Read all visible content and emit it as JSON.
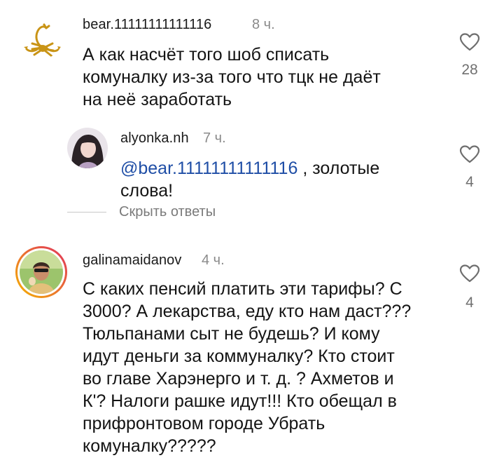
{
  "comments": [
    {
      "username": "bear.11111111111116",
      "time": "8 ч.",
      "text_lines": [
        "А как насчёт того шоб списать",
        "комуналку из-за того что тцк не даёт",
        "на неё заработать"
      ],
      "likes": "28",
      "avatar_icon": "scorpion-icon"
    },
    {
      "username": "alyonka.nh",
      "time": "7 ч.",
      "mention": "@bear.11111111111116",
      "text_after_mention": " , золотые",
      "text_line2": "слова!",
      "likes": "4",
      "avatar_icon": "girl-avatar"
    },
    {
      "username": "galinamaidanov",
      "time": "4 ч.",
      "text_lines": [
        "С каких пенсий платить эти тарифы? С",
        "3000? А лекарства, еду кто нам даст???",
        "Тюльпанами сыт не будешь? И кому",
        "идут деньги за коммуналку?  Кто стоит",
        "во главе Харэнерго и т. д. ? Ахметов и",
        "К'? Налоги рашке идут!!! Кто обещал в",
        "прифронтовом городе  Убрать",
        "комуналку?????"
      ],
      "likes": "4",
      "avatar_icon": "woman-avatar-story-ring"
    }
  ],
  "hide_replies_label": "Скрыть ответы",
  "colors": {
    "mention": "#1f4ea6",
    "story_ring_start": "#f5b400",
    "story_ring_end": "#e0305f"
  }
}
